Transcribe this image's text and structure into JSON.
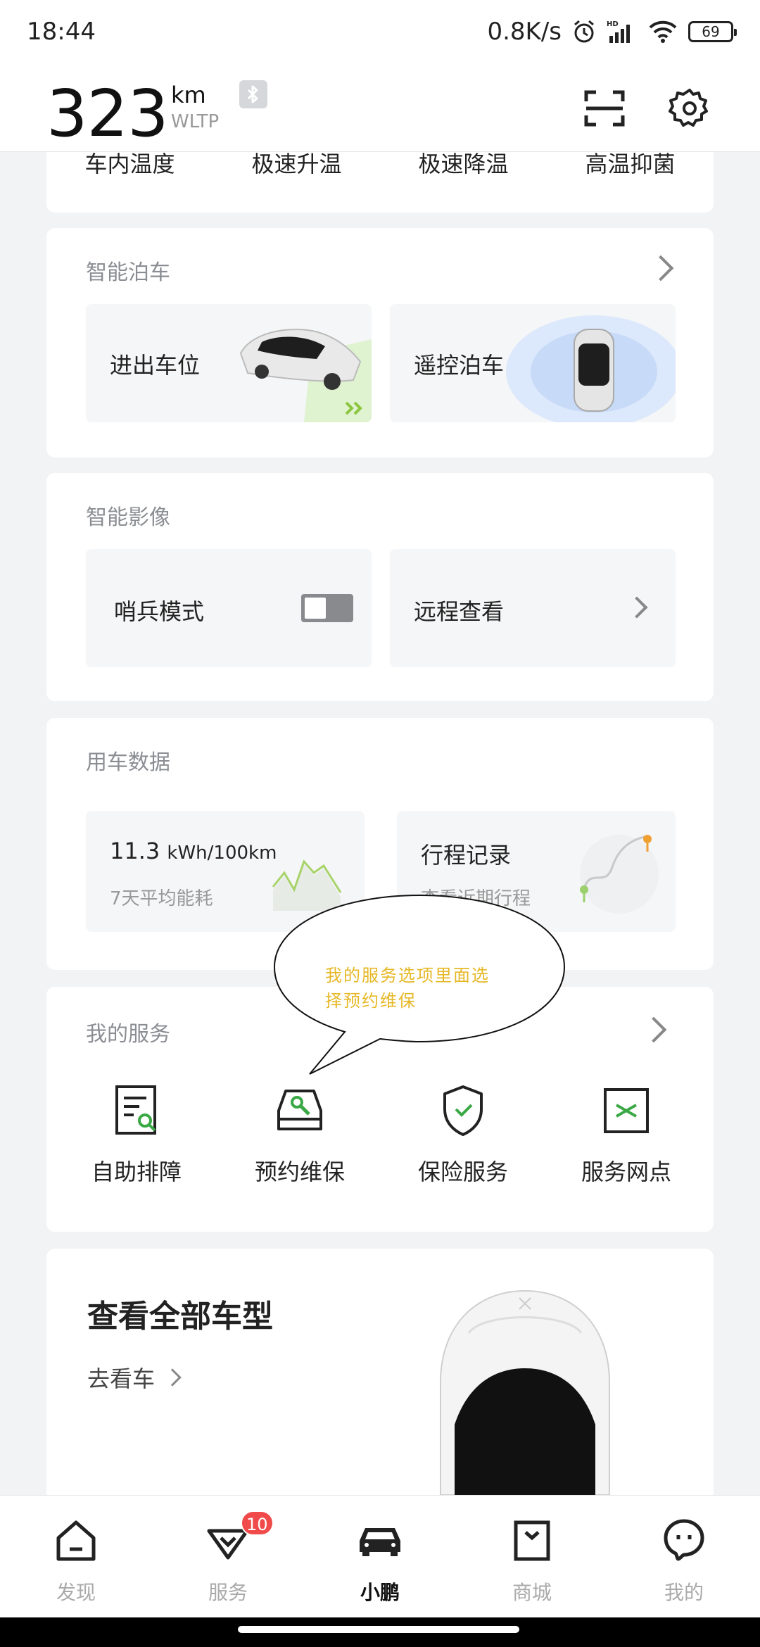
{
  "status": {
    "time": "18:44",
    "speed": "0.8K/s",
    "battery": "69"
  },
  "header": {
    "range_value": "323",
    "range_unit": "km",
    "range_standard": "WLTP"
  },
  "climate": {
    "items": [
      "车内温度",
      "极速升温",
      "极速降温",
      "高温抑菌"
    ]
  },
  "parking": {
    "title": "智能泊车",
    "tiles": [
      "进出车位",
      "遥控泊车"
    ]
  },
  "camera": {
    "title": "智能影像",
    "sentry_label": "哨兵模式",
    "sentry_on": false,
    "remote_label": "远程查看"
  },
  "usage": {
    "title": "用车数据",
    "energy_value": "11.3",
    "energy_unit": "kWh/100km",
    "energy_caption": "7天平均能耗",
    "trip_title": "行程记录",
    "trip_caption": "查看近期行程"
  },
  "annotation": {
    "line1": "我的服务选项里面选",
    "line2": "择预约维保"
  },
  "services": {
    "title": "我的服务",
    "items": [
      "自助排障",
      "预约维保",
      "保险服务",
      "服务网点"
    ]
  },
  "models": {
    "title": "查看全部车型",
    "link": "去看车"
  },
  "tabbar": {
    "items": [
      "发现",
      "服务",
      "小鹏",
      "商城",
      "我的"
    ],
    "active": "小鹏",
    "service_badge": "10"
  }
}
